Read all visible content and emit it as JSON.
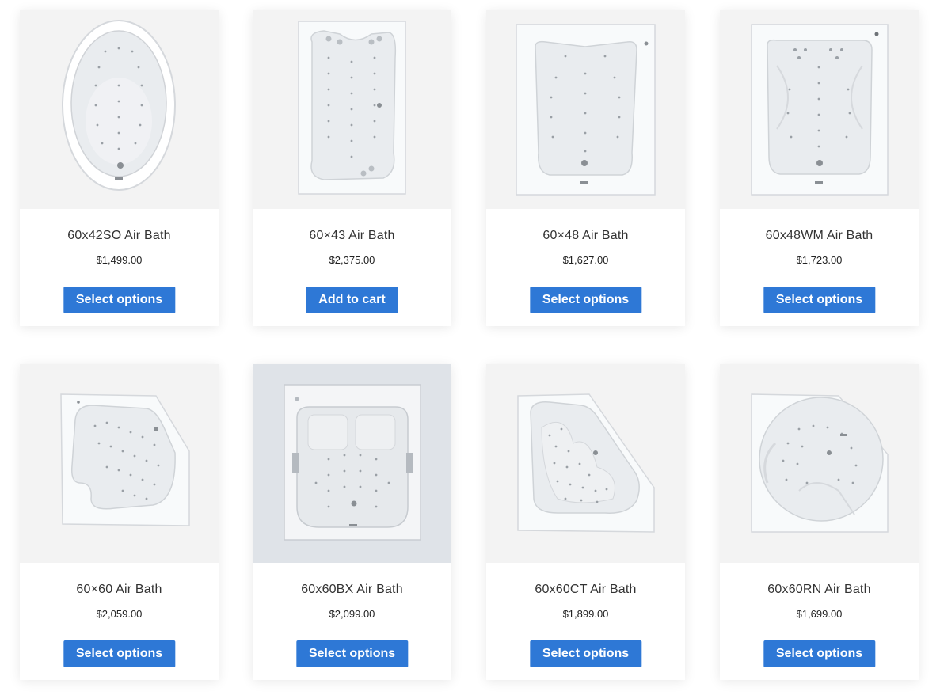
{
  "products": [
    {
      "title": "60x42SO Air Bath",
      "price": "$1,499.00",
      "button": "Select options",
      "image": "oval-air-tub"
    },
    {
      "title": "60×43 Air Bath",
      "price": "$2,375.00",
      "button": "Add to cart",
      "image": "rectangle-air-tub"
    },
    {
      "title": "60×48 Air Bath",
      "price": "$1,627.00",
      "button": "Select options",
      "image": "rectangle-air-tub"
    },
    {
      "title": "60x48WM Air Bath",
      "price": "$1,723.00",
      "button": "Select options",
      "image": "rectangle-air-tub"
    },
    {
      "title": "60×60 Air Bath",
      "price": "$2,059.00",
      "button": "Select options",
      "image": "corner-air-tub"
    },
    {
      "title": "60x60BX Air Bath",
      "price": "$2,099.00",
      "button": "Select options",
      "image": "square-air-tub"
    },
    {
      "title": "60x60CT Air Bath",
      "price": "$1,899.00",
      "button": "Select options",
      "image": "corner-air-tub"
    },
    {
      "title": "60x60RN Air Bath",
      "price": "$1,699.00",
      "button": "Select options",
      "image": "corner-air-tub"
    }
  ],
  "colors": {
    "button": "#2e78d6",
    "button_text": "#ffffff",
    "tub_fill": "#ffffff",
    "tub_inner": "#e9ecef",
    "jet_dot": "#9aa0a6"
  }
}
